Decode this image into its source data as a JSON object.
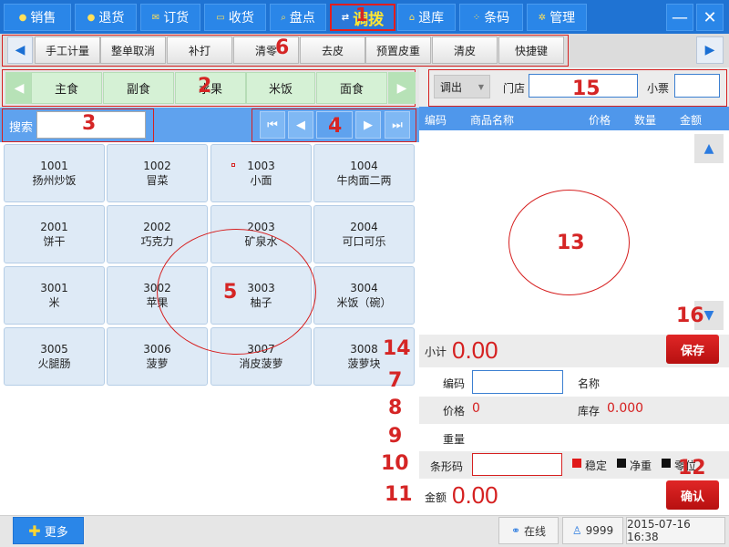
{
  "tabs": [
    {
      "label": "销售",
      "icon": "dot-icon"
    },
    {
      "label": "退货",
      "icon": "dot-icon"
    },
    {
      "label": "订货",
      "icon": "chat-icon"
    },
    {
      "label": "收货",
      "icon": "doc-icon"
    },
    {
      "label": "盘点",
      "icon": "search-icon"
    },
    {
      "label": "调拨",
      "icon": "swap-icon",
      "active": true
    },
    {
      "label": "退库",
      "icon": "home-icon"
    },
    {
      "label": "条码",
      "icon": "grid-icon"
    },
    {
      "label": "管理",
      "icon": "gear-icon"
    }
  ],
  "window": {
    "minimize": "—",
    "close": "✕"
  },
  "toolbar": [
    "手工计量",
    "整单取消",
    "补打",
    "清零",
    "去皮",
    "预置皮重",
    "清皮",
    "快捷键"
  ],
  "categories": [
    "主食",
    "副食",
    "水果",
    "米饭",
    "面食"
  ],
  "search": {
    "label": "搜索",
    "value": ""
  },
  "pager": {
    "page": "1"
  },
  "products": [
    {
      "code": "1001",
      "name": "扬州炒饭"
    },
    {
      "code": "1002",
      "name": "冒菜"
    },
    {
      "code": "1003",
      "name": "小面"
    },
    {
      "code": "1004",
      "name": "牛肉面二两"
    },
    {
      "code": "2001",
      "name": "饼干"
    },
    {
      "code": "2002",
      "name": "巧克力"
    },
    {
      "code": "2003",
      "name": "矿泉水"
    },
    {
      "code": "2004",
      "name": "可口可乐"
    },
    {
      "code": "3001",
      "name": "米"
    },
    {
      "code": "3002",
      "name": "苹果"
    },
    {
      "code": "3003",
      "name": "柚子"
    },
    {
      "code": "3004",
      "name": "米饭（碗）"
    },
    {
      "code": "3005",
      "name": "火腿肠"
    },
    {
      "code": "3006",
      "name": "菠萝"
    },
    {
      "code": "3007",
      "name": "消皮菠萝"
    },
    {
      "code": "3008",
      "name": "菠萝块"
    }
  ],
  "transfer": {
    "type": "调出",
    "store_label": "门店",
    "store_value": "",
    "ticket_label": "小票",
    "ticket_value": ""
  },
  "table_headers": [
    "编码",
    "商品名称",
    "价格",
    "数量",
    "金额"
  ],
  "summary": {
    "subtotal_label": "小计",
    "subtotal_value": "0.00",
    "save_label": "保存"
  },
  "form": {
    "code_label": "编码",
    "code_value": "",
    "name_label": "名称",
    "price_label": "价格",
    "price_value": "0",
    "stock_label": "库存",
    "stock_value": "0.000",
    "weight_label": "重量",
    "barcode_label": "条形码",
    "barcode_value": "",
    "status": [
      "稳定",
      "净重",
      "零位"
    ],
    "amount_label": "金额",
    "amount_value": "0.00",
    "confirm_label": "确认"
  },
  "footer": {
    "more_label": "更多",
    "online_label": "在线",
    "user_label": "9999",
    "datetime": "2015-07-16 16:38"
  },
  "annotations": [
    "1",
    "2",
    "3",
    "4",
    "5",
    "6",
    "7",
    "8",
    "9",
    "10",
    "11",
    "12",
    "13",
    "14",
    "15",
    "16"
  ],
  "colors": {
    "accent": "#1f73d3",
    "highlight_red": "#d62020",
    "product_bg": "#deeaf6",
    "category_bg": "#d5f1d5"
  }
}
